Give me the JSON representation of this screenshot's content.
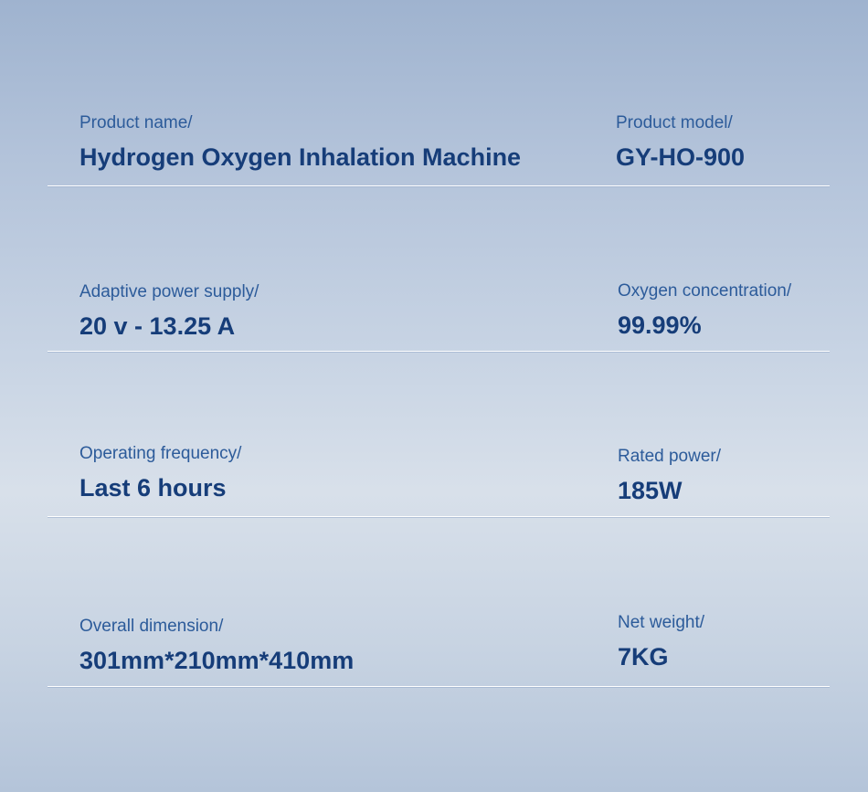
{
  "specs": [
    {
      "left_label": "Product name/",
      "left_value": "Hydrogen Oxygen Inhalation Machine",
      "right_label": "Product model/",
      "right_value": "GY-HO-900"
    },
    {
      "left_label": "Adaptive power supply/",
      "left_value": "20 v - 13.25 A",
      "right_label": "Oxygen concentration/",
      "right_value": "99.99%"
    },
    {
      "left_label": "Operating frequency/",
      "left_value": "Last 6 hours",
      "right_label": "Rated power/",
      "right_value": "185W"
    },
    {
      "left_label": "Overall dimension/",
      "left_value": "301mm*210mm*410mm",
      "right_label": "Net weight/",
      "right_value": "7KG"
    }
  ]
}
